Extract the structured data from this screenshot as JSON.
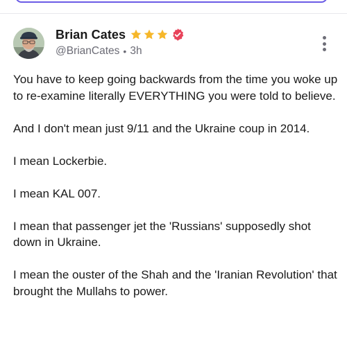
{
  "colors": {
    "accent_outline": "#6a5be6",
    "star": "#f6b72a",
    "verified_badge": "#e8435a",
    "secondary_text": "#6b6b75"
  },
  "post": {
    "author": {
      "display_name": "Brian Cates",
      "handle": "@BrianCates",
      "time_separator": "•",
      "time_ago": "3h",
      "star_count": 3,
      "badge_icon": "verified-badge-icon"
    },
    "menu_icon": "more-vertical-icon",
    "paragraphs": [
      "You have to keep going backwards from the time you woke up to re-examine literally EVERYTHING you were told to believe.",
      "And I don't mean just 9/11 and the Ukraine coup in 2014.",
      "I mean Lockerbie.",
      "I mean KAL 007.",
      "I mean that passenger jet the 'Russians' supposedly shot down in Ukraine.",
      "I mean the ouster of the Shah and the 'Iranian Revolution' that brought the Mullahs to power."
    ]
  }
}
